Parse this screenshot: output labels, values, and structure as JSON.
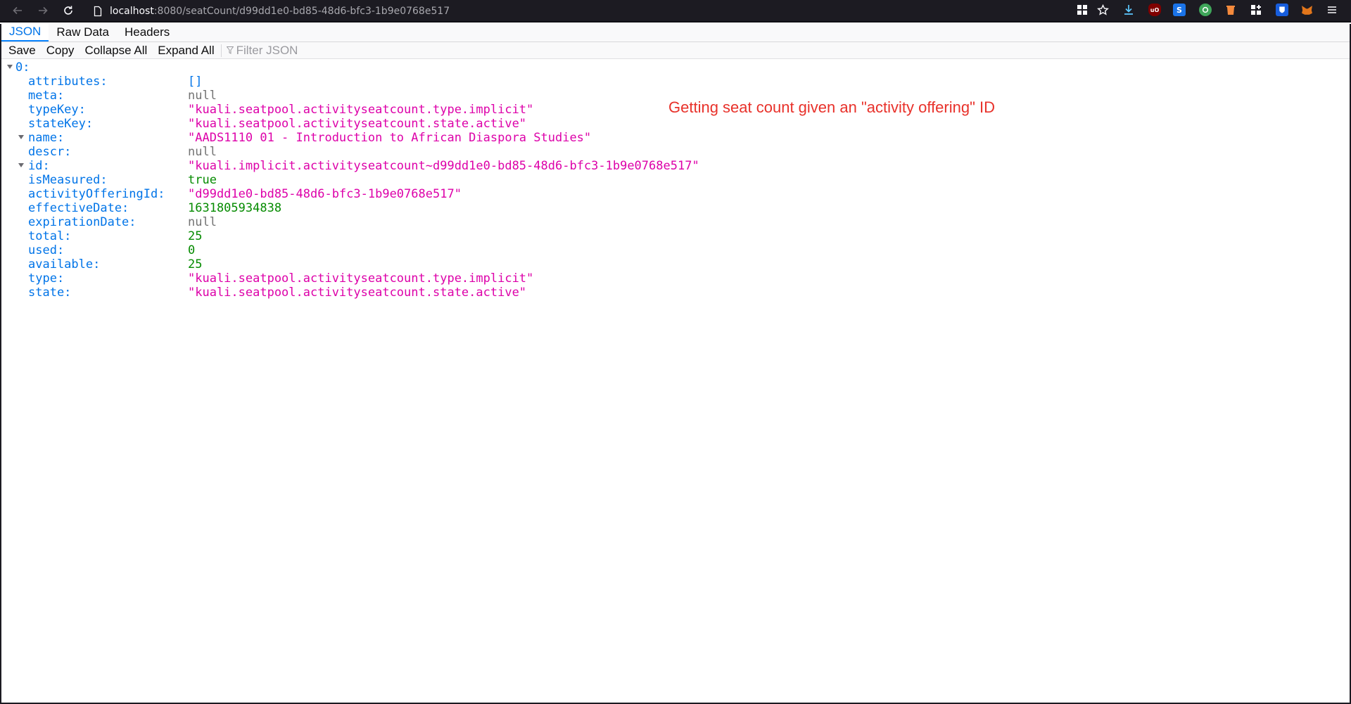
{
  "browser": {
    "url_host": "localhost",
    "url_path": ":8080/seatCount/d99dd1e0-bd85-48d6-bfc3-1b9e0768e517"
  },
  "viewer": {
    "tabs": [
      "JSON",
      "Raw Data",
      "Headers"
    ],
    "active_tab": "JSON",
    "toolbar": {
      "save": "Save",
      "copy": "Copy",
      "collapse_all": "Collapse All",
      "expand_all": "Expand All",
      "filter_placeholder": "Filter JSON"
    }
  },
  "annotation": "Getting seat count given an \"activity offering\" ID",
  "tree": {
    "root_key": "0:",
    "rows": [
      {
        "key": "attributes:",
        "value": "[]",
        "kind": "array",
        "twisty": false
      },
      {
        "key": "meta:",
        "value": "null",
        "kind": "null",
        "twisty": false
      },
      {
        "key": "typeKey:",
        "value": "\"kuali.seatpool.activityseatcount.type.implicit\"",
        "kind": "string",
        "twisty": false
      },
      {
        "key": "stateKey:",
        "value": "\"kuali.seatpool.activityseatcount.state.active\"",
        "kind": "string",
        "twisty": false
      },
      {
        "key": "name:",
        "value": "\"AADS1110 01 - Introduction to African Diaspora Studies\"",
        "kind": "string",
        "twisty": true
      },
      {
        "key": "descr:",
        "value": "null",
        "kind": "null",
        "twisty": false
      },
      {
        "key": "id:",
        "value": "\"kuali.implicit.activityseatcount~d99dd1e0-bd85-48d6-bfc3-1b9e0768e517\"",
        "kind": "string",
        "twisty": true
      },
      {
        "key": "isMeasured:",
        "value": "true",
        "kind": "bool",
        "twisty": false
      },
      {
        "key": "activityOfferingId:",
        "value": "\"d99dd1e0-bd85-48d6-bfc3-1b9e0768e517\"",
        "kind": "string",
        "twisty": false
      },
      {
        "key": "effectiveDate:",
        "value": "1631805934838",
        "kind": "number",
        "twisty": false
      },
      {
        "key": "expirationDate:",
        "value": "null",
        "kind": "null",
        "twisty": false
      },
      {
        "key": "total:",
        "value": "25",
        "kind": "number",
        "twisty": false
      },
      {
        "key": "used:",
        "value": "0",
        "kind": "number",
        "twisty": false
      },
      {
        "key": "available:",
        "value": "25",
        "kind": "number",
        "twisty": false
      },
      {
        "key": "type:",
        "value": "\"kuali.seatpool.activityseatcount.type.implicit\"",
        "kind": "string",
        "twisty": false
      },
      {
        "key": "state:",
        "value": "\"kuali.seatpool.activityseatcount.state.active\"",
        "kind": "string",
        "twisty": false
      }
    ]
  },
  "colors": {
    "chrome_bg": "#1c1b22",
    "key": "#0074e8",
    "string": "#dd00a9",
    "number": "#058b00",
    "null": "#737373",
    "annotation": "#e8312a"
  }
}
